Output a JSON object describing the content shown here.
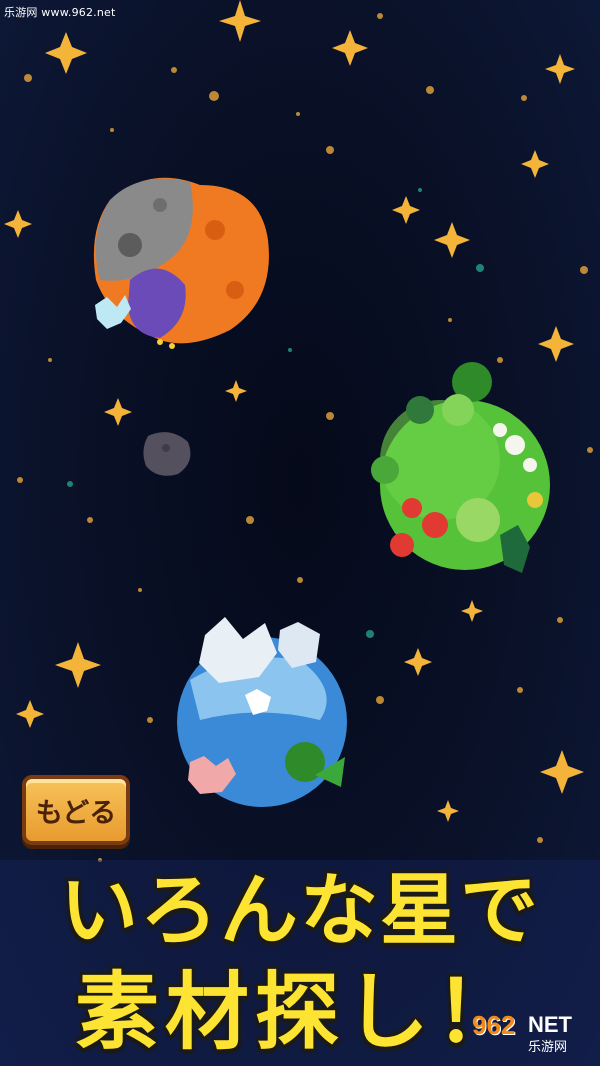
{
  "watermark_top": "乐游网 www.962.net",
  "back_button_label": "もどる",
  "headline": {
    "line1": "いろんな星で",
    "line2": "素材探し！"
  },
  "watermark_logo": {
    "number": "962",
    "suffix": "NET",
    "chinese": "乐游网"
  },
  "colors": {
    "headline": "#fde433",
    "button": "#f0ae40",
    "background": "#0a1128"
  },
  "planets": [
    "rocky-asteroid-planet",
    "green-forest-planet",
    "ice-ocean-planet",
    "small-asteroid"
  ]
}
